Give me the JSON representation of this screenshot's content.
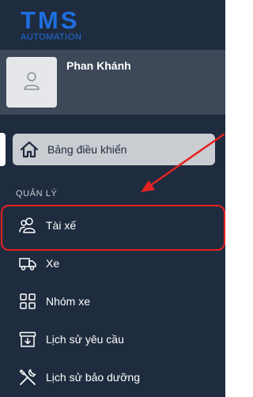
{
  "brand": {
    "name": "TMS",
    "subtitle": "AUTOMATION"
  },
  "profile": {
    "name": "Phan Khánh",
    "avatar_icon": "user-icon"
  },
  "nav": {
    "dashboard": {
      "label": "Bảng điều khiển",
      "icon": "home-icon"
    },
    "section_title": "QUẢN LÝ",
    "items": [
      {
        "label": "Tài xế",
        "icon": "users-icon"
      },
      {
        "label": "Xe",
        "icon": "truck-icon"
      },
      {
        "label": "Nhóm xe",
        "icon": "grid-icon"
      },
      {
        "label": "Lịch sử yêu cầu",
        "icon": "archive-icon"
      },
      {
        "label": "Lịch sử bảo dưỡng",
        "icon": "tools-icon"
      }
    ]
  },
  "colors": {
    "sidebar_bg": "#1f2c3f",
    "brand_blue": "#1e6fe0",
    "annotation_red": "#e32222"
  }
}
